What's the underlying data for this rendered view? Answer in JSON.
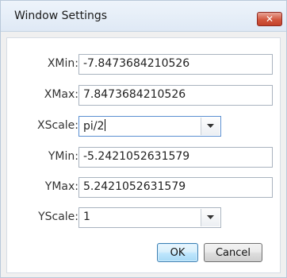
{
  "window": {
    "title": "Window Settings",
    "close_glyph": "✕"
  },
  "fields": [
    {
      "label": "XMin:",
      "value": "-7.8473684210526"
    },
    {
      "label": "XMax:",
      "value": "7.8473684210526"
    },
    {
      "label": "YMin:",
      "value": "-5.2421052631579"
    },
    {
      "label": "YMax:",
      "value": "5.2421052631579"
    }
  ],
  "xscale": {
    "label": "XScale:",
    "value": "pi/2"
  },
  "yscale": {
    "label": "YScale:",
    "value": "1"
  },
  "buttons": {
    "ok": "OK",
    "cancel": "Cancel"
  },
  "colors": {
    "close_button": "#d2573e",
    "ok_border": "#3c7fb1",
    "focus_border": "#5b8fd1"
  },
  "icons": {
    "close": "close-icon",
    "dropdown": "chevron-down-icon"
  }
}
